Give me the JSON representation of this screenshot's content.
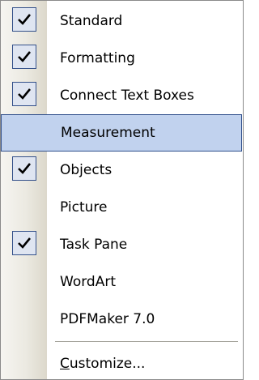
{
  "menu": {
    "items": [
      {
        "label": "Standard",
        "checked": true,
        "highlighted": false
      },
      {
        "label": "Formatting",
        "checked": true,
        "highlighted": false
      },
      {
        "label": "Connect Text Boxes",
        "checked": true,
        "highlighted": false
      },
      {
        "label": "Measurement",
        "checked": false,
        "highlighted": true
      },
      {
        "label": "Objects",
        "checked": true,
        "highlighted": false
      },
      {
        "label": "Picture",
        "checked": false,
        "highlighted": false
      },
      {
        "label": "Task Pane",
        "checked": true,
        "highlighted": false
      },
      {
        "label": "WordArt",
        "checked": false,
        "highlighted": false
      },
      {
        "label": "PDFMaker 7.0",
        "checked": false,
        "highlighted": false
      }
    ],
    "customize": {
      "mnemonic": "C",
      "rest": "ustomize..."
    }
  },
  "colors": {
    "highlight": "#c1d2ee",
    "highlight_border": "#31508c",
    "check_box": "#dfe5f1",
    "check_border": "#33508a"
  },
  "icons": {
    "check": "check-mark-icon"
  }
}
